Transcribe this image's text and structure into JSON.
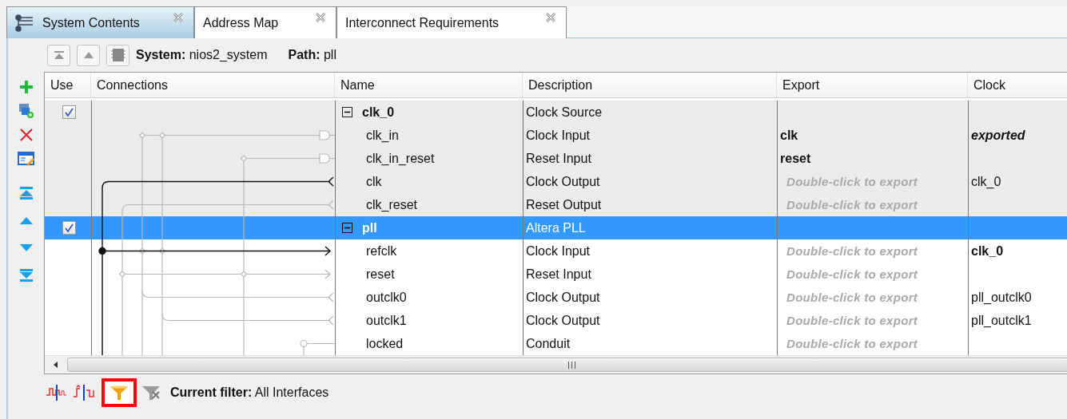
{
  "tabs": [
    {
      "label": "System Contents",
      "selected": true
    },
    {
      "label": "Address Map",
      "selected": false
    },
    {
      "label": "Interconnect Requirements",
      "selected": false
    }
  ],
  "toolbar": {
    "system": "**System:** nios2_system",
    "path": "**Path:** pll"
  },
  "table": {
    "columns": [
      "Use",
      "Connections",
      "Name",
      "Description",
      "Export",
      "Clock"
    ],
    "rows": [
      {
        "kind": "module",
        "use": true,
        "expanded": true,
        "selected": false,
        "name": "clk_0",
        "description": "Clock Source"
      },
      {
        "kind": "interface",
        "name": "clk_in",
        "description": "Clock Input",
        "export": {
          "kind": "name",
          "text": "clk"
        },
        "clock": {
          "kind": "exported",
          "text": "exported"
        }
      },
      {
        "kind": "interface",
        "name": "clk_in_reset",
        "description": "Reset Input",
        "export": {
          "kind": "name",
          "text": "reset"
        }
      },
      {
        "kind": "interface",
        "name": "clk",
        "description": "Clock Output",
        "export": {
          "kind": "hint",
          "text": "Double-click to export"
        },
        "clock": {
          "kind": "source",
          "text": "clk_0"
        }
      },
      {
        "kind": "interface",
        "name": "clk_reset",
        "description": "Reset Output",
        "export": {
          "kind": "hint",
          "text": "Double-click to export"
        }
      },
      {
        "kind": "module",
        "use": true,
        "expanded": true,
        "selected": true,
        "name": "pll",
        "description": "Altera PLL"
      },
      {
        "kind": "interface",
        "name": "refclk",
        "description": "Clock Input",
        "export": {
          "kind": "hint",
          "text": "Double-click to export"
        },
        "clock": {
          "kind": "connected",
          "text": "clk_0"
        }
      },
      {
        "kind": "interface",
        "name": "reset",
        "description": "Reset Input",
        "export": {
          "kind": "hint",
          "text": "Double-click to export"
        }
      },
      {
        "kind": "interface",
        "name": "outclk0",
        "description": "Clock Output",
        "export": {
          "kind": "hint",
          "text": "Double-click to export"
        },
        "clock": {
          "kind": "source",
          "text": "pll_outclk0"
        }
      },
      {
        "kind": "interface",
        "name": "outclk1",
        "description": "Clock Output",
        "export": {
          "kind": "hint",
          "text": "Double-click to export"
        },
        "clock": {
          "kind": "source",
          "text": "pll_outclk1"
        }
      },
      {
        "kind": "interface",
        "name": "locked",
        "description": "Conduit",
        "export": {
          "kind": "hint",
          "text": "Double-click to export"
        }
      }
    ]
  },
  "filter": {
    "text": "**Current filter:** All Interfaces"
  }
}
